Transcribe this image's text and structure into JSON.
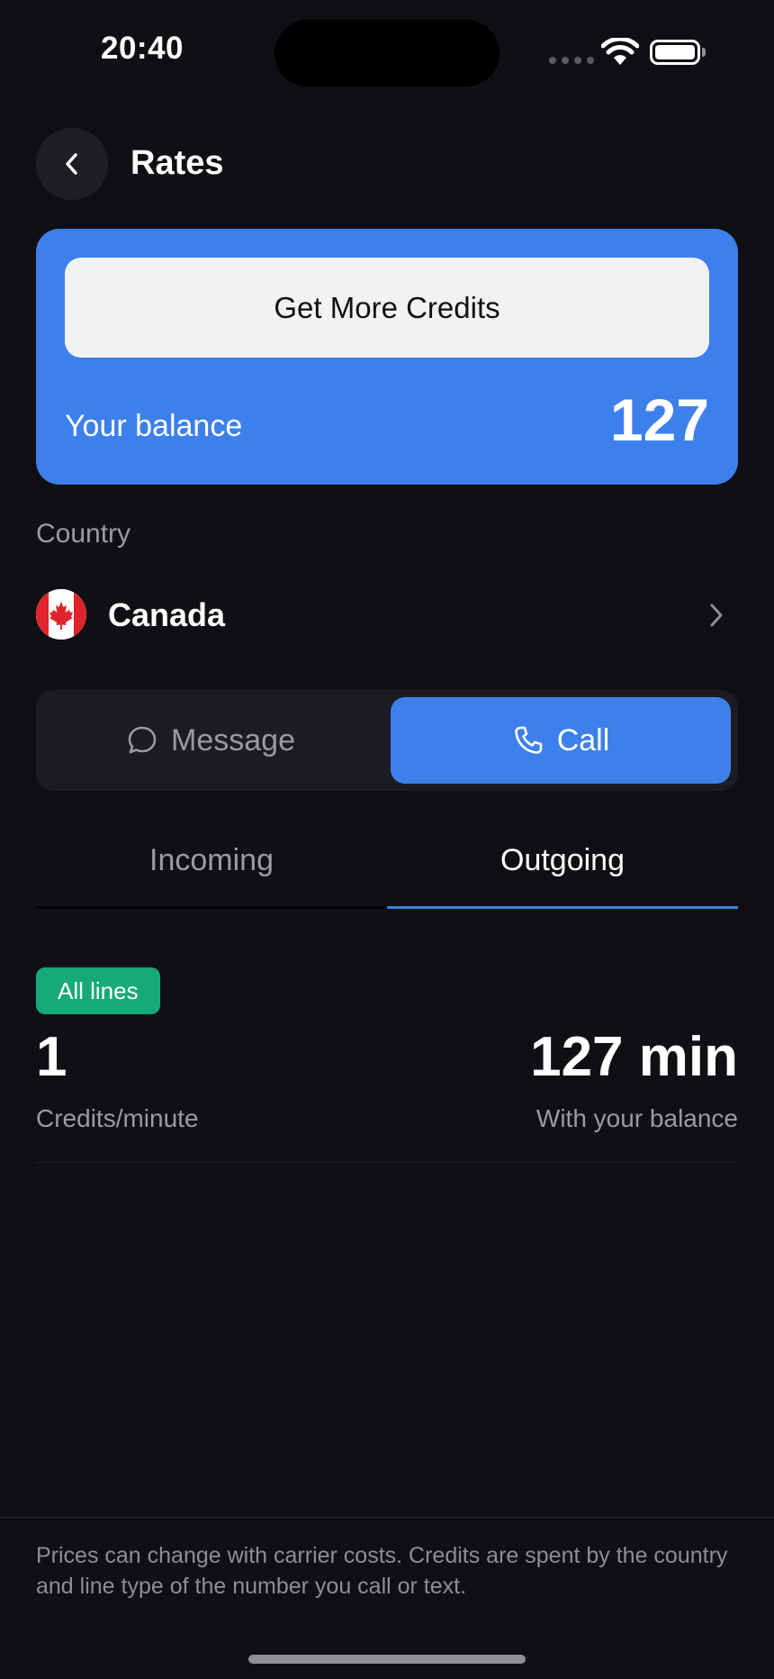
{
  "status_bar": {
    "time": "20:40"
  },
  "header": {
    "title": "Rates",
    "back_icon": "chevron-left-icon"
  },
  "balance_card": {
    "button_label": "Get More Credits",
    "balance_label": "Your balance",
    "balance_value": "127",
    "accent_color": "#3d80ec"
  },
  "country": {
    "label": "Country",
    "name": "Canada",
    "flag_icon": "canada-flag-icon"
  },
  "segments": {
    "message_label": "Message",
    "call_label": "Call",
    "selected": "Call"
  },
  "tabs": {
    "incoming_label": "Incoming",
    "outgoing_label": "Outgoing",
    "selected": "Outgoing"
  },
  "rate": {
    "badge": "All lines",
    "badge_color": "#17a979",
    "credits_value": "1",
    "credits_label": "Credits/minute",
    "minutes_value": "127 min",
    "minutes_label": "With your balance"
  },
  "footer": {
    "note": "Prices can change with carrier costs. Credits are spent by the country and line type of the number you call or text."
  }
}
